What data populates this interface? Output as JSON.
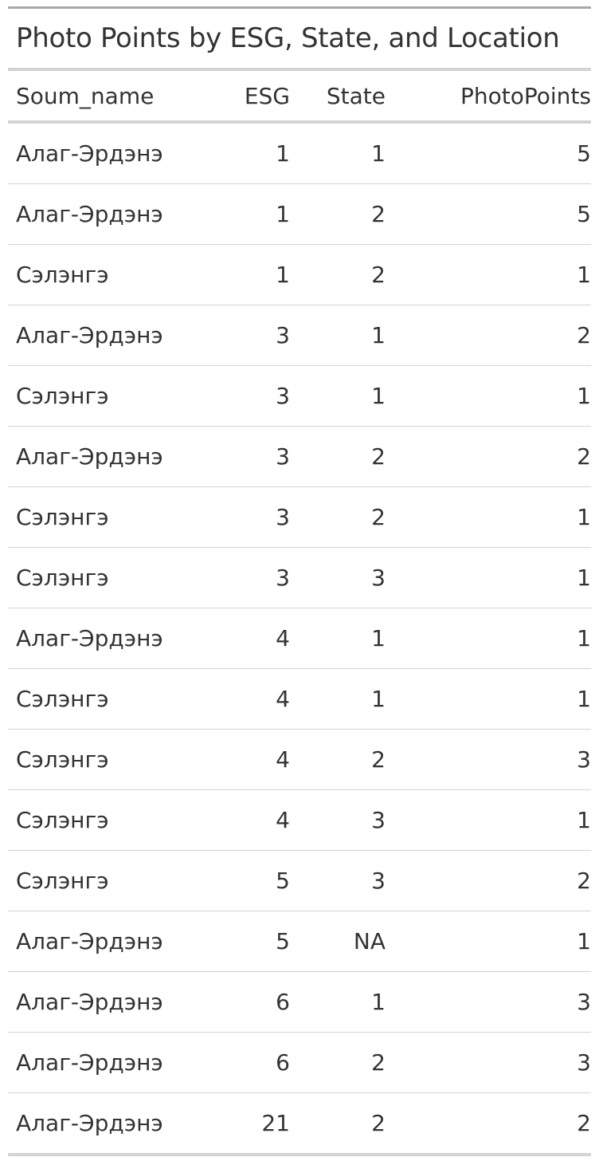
{
  "table": {
    "title": "Photo Points by ESG, State, and Location",
    "columns": [
      "Soum_name",
      "ESG",
      "State",
      "PhotoPoints"
    ],
    "rows": [
      [
        "Алаг-Эрдэнэ",
        "1",
        "1",
        "5"
      ],
      [
        "Алаг-Эрдэнэ",
        "1",
        "2",
        "5"
      ],
      [
        "Сэлэнгэ",
        "1",
        "2",
        "1"
      ],
      [
        "Алаг-Эрдэнэ",
        "3",
        "1",
        "2"
      ],
      [
        "Сэлэнгэ",
        "3",
        "1",
        "1"
      ],
      [
        "Алаг-Эрдэнэ",
        "3",
        "2",
        "2"
      ],
      [
        "Сэлэнгэ",
        "3",
        "2",
        "1"
      ],
      [
        "Сэлэнгэ",
        "3",
        "3",
        "1"
      ],
      [
        "Алаг-Эрдэнэ",
        "4",
        "1",
        "1"
      ],
      [
        "Сэлэнгэ",
        "4",
        "1",
        "1"
      ],
      [
        "Сэлэнгэ",
        "4",
        "2",
        "3"
      ],
      [
        "Сэлэнгэ",
        "4",
        "3",
        "1"
      ],
      [
        "Сэлэнгэ",
        "5",
        "3",
        "2"
      ],
      [
        "Алаг-Эрдэнэ",
        "5",
        "NA",
        "1"
      ],
      [
        "Алаг-Эрдэнэ",
        "6",
        "1",
        "3"
      ],
      [
        "Алаг-Эрдэнэ",
        "6",
        "2",
        "3"
      ],
      [
        "Алаг-Эрдэнэ",
        "21",
        "2",
        "2"
      ]
    ]
  }
}
